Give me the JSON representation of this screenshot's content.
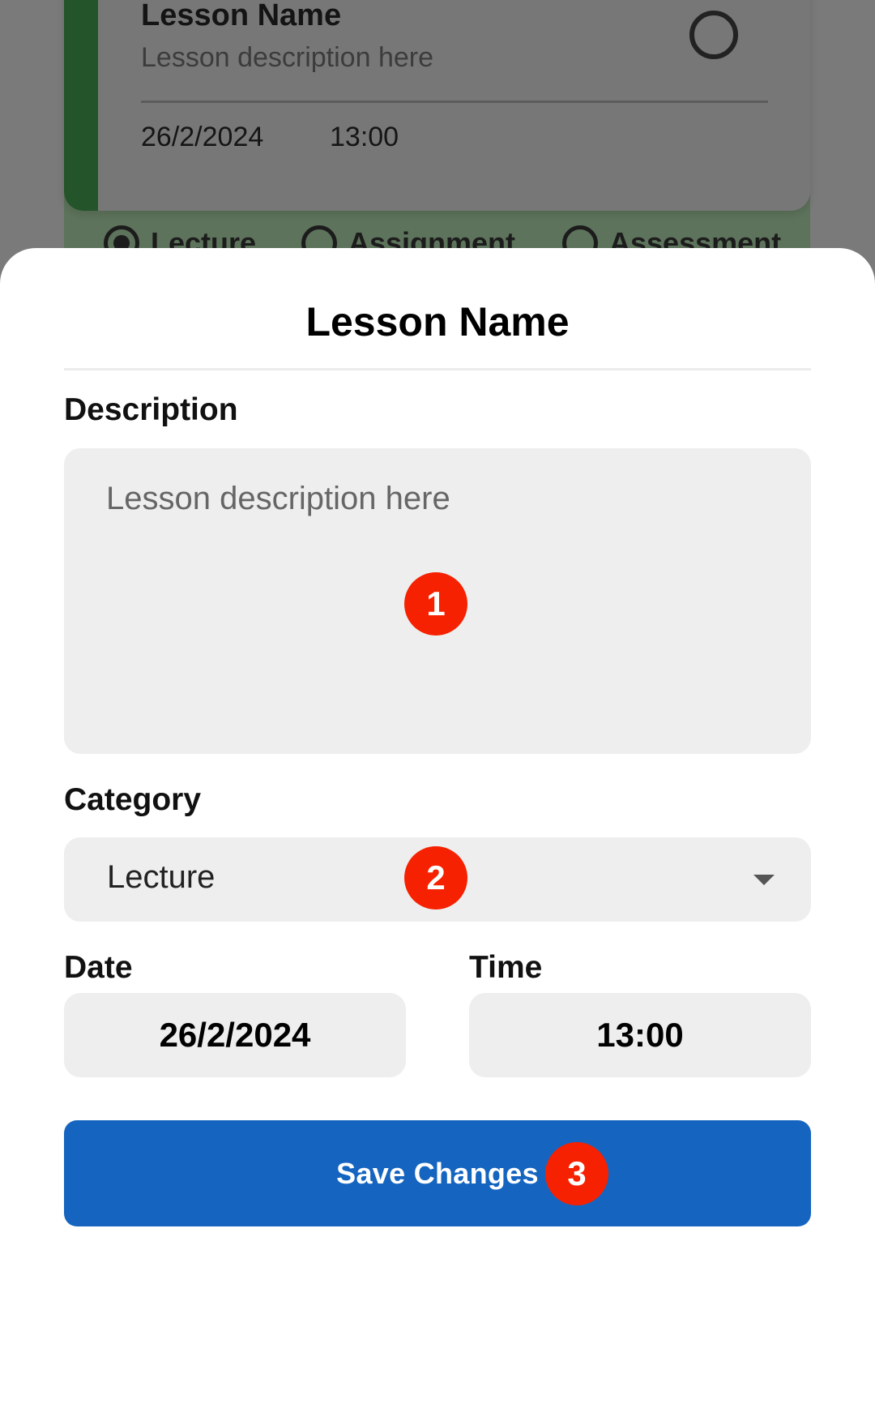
{
  "background_card": {
    "title": "Lesson Name",
    "description": "Lesson description here",
    "date": "26/2/2024",
    "time": "13:00",
    "accent_color": "#2e7d32",
    "radio_options": [
      {
        "label": "Lecture",
        "selected": true
      },
      {
        "label": "Assignment",
        "selected": false
      },
      {
        "label": "Assessment",
        "selected": false
      }
    ]
  },
  "sheet": {
    "title": "Lesson Name",
    "description_label": "Description",
    "description_placeholder": "Lesson description here",
    "description_value": "",
    "category_label": "Category",
    "category_value": "Lecture",
    "date_label": "Date",
    "date_value": "26/2/2024",
    "time_label": "Time",
    "time_value": "13:00",
    "save_label": "Save Changes",
    "save_color": "#1565c0"
  },
  "markers": [
    "1",
    "2",
    "3"
  ],
  "marker_color": "#f62100"
}
